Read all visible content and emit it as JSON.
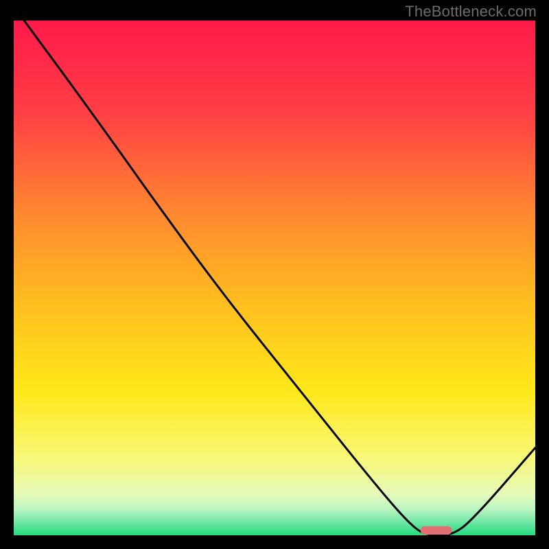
{
  "watermark": "TheBottleneck.com",
  "chart_data": {
    "type": "line",
    "title": "",
    "xlabel": "",
    "ylabel": "",
    "xlim": [
      0,
      100
    ],
    "ylim": [
      0,
      100
    ],
    "series": [
      {
        "name": "curve",
        "x": [
          2,
          10,
          20,
          27,
          40,
          55,
          70,
          77,
          80,
          84,
          88,
          100
        ],
        "y": [
          100,
          89,
          75,
          65,
          47,
          28,
          9,
          1,
          0,
          0,
          3,
          17
        ]
      }
    ],
    "marker": {
      "x": 81,
      "y": 0,
      "width": 6,
      "height": 1.1
    },
    "gradient_stops": [
      {
        "offset": 0,
        "color": "#ff1a4a"
      },
      {
        "offset": 18,
        "color": "#ff3f45"
      },
      {
        "offset": 38,
        "color": "#ff8a2f"
      },
      {
        "offset": 55,
        "color": "#ffbe1f"
      },
      {
        "offset": 72,
        "color": "#ffe81a"
      },
      {
        "offset": 85,
        "color": "#f8f879"
      },
      {
        "offset": 92,
        "color": "#e6fbb9"
      },
      {
        "offset": 95,
        "color": "#b9f4c2"
      },
      {
        "offset": 97,
        "color": "#7de9ab"
      },
      {
        "offset": 100,
        "color": "#24da7d"
      }
    ]
  }
}
